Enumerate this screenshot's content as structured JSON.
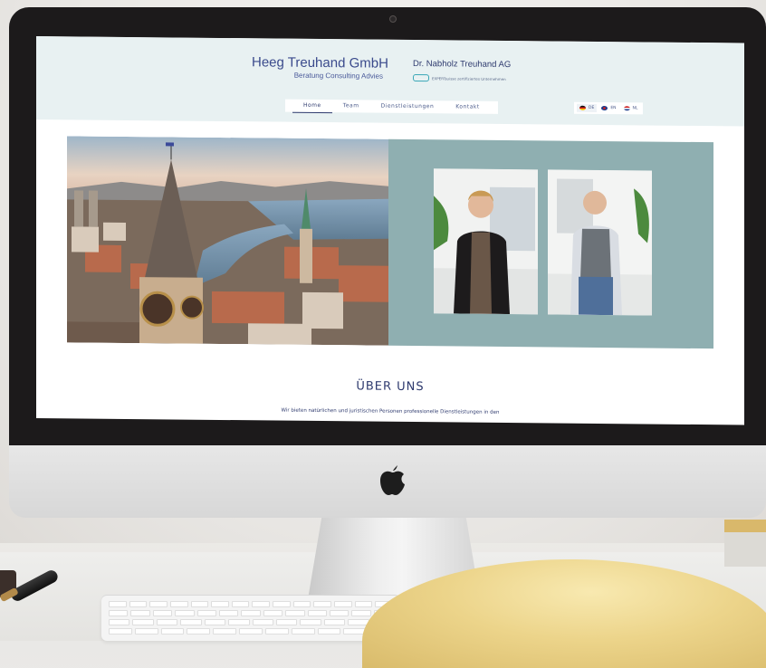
{
  "site": {
    "brand_title": "Heeg Treuhand GmbH",
    "brand_subtitle": "Beratung Consulting Advies",
    "partner_name": "Dr. Nabholz Treuhand AG",
    "partner_note": "EXPERTsuisse zertifiziertes Unternehmen",
    "nav": [
      {
        "label": "Home",
        "active": true
      },
      {
        "label": "Team",
        "active": false
      },
      {
        "label": "Dienstleistungen",
        "active": false
      },
      {
        "label": "Kontakt",
        "active": false
      }
    ],
    "languages": [
      {
        "code": "DE",
        "active": true
      },
      {
        "code": "EN",
        "active": false
      },
      {
        "code": "NL",
        "active": false
      }
    ],
    "about_title": "ÜBER UNS",
    "about_text": "Wir bieten natürlichen und juristischen Personen professionelle Dienstleistungen in den"
  },
  "colors": {
    "header_bg": "#e8f1f2",
    "brand_blue": "#3a4a8c",
    "hero_teal": "#8fafb1",
    "bezel": "#1c1a1b"
  },
  "icons": {
    "apple": "apple-logo-icon",
    "expert": "expertsuisse-icon"
  }
}
